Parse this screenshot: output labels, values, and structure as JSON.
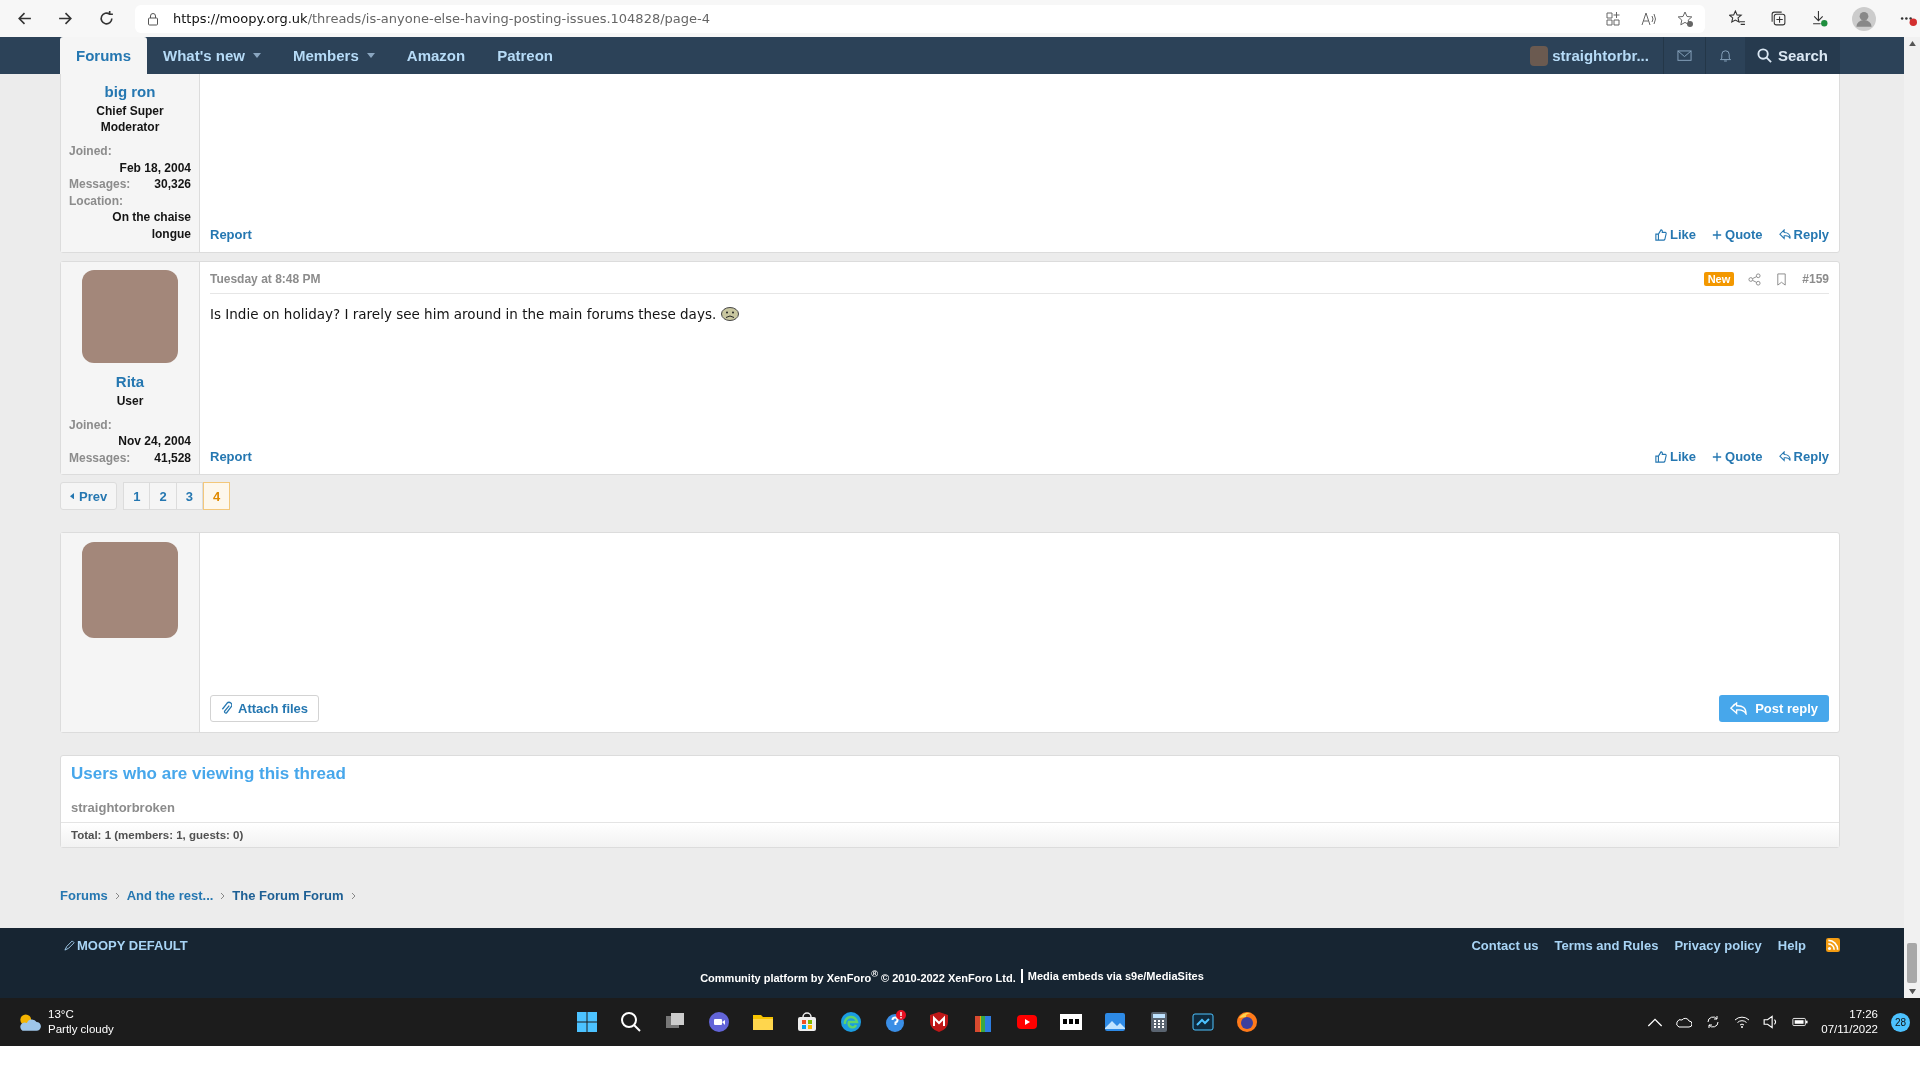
{
  "browser": {
    "url_host": "https://moopy.org.uk",
    "url_path": "/threads/is-anyone-else-having-posting-issues.104828/page-4"
  },
  "nav": {
    "items": [
      {
        "label": "Forums",
        "selected": true,
        "dropdown": false
      },
      {
        "label": "What's new",
        "selected": false,
        "dropdown": true
      },
      {
        "label": "Members",
        "selected": false,
        "dropdown": true
      },
      {
        "label": "Amazon",
        "selected": false,
        "dropdown": false
      },
      {
        "label": "Patreon",
        "selected": false,
        "dropdown": false
      }
    ],
    "user": "straightorbr...",
    "search": "Search"
  },
  "posts": [
    {
      "author": "big ron",
      "role": "Chief Super Moderator",
      "stats": [
        {
          "label": "Joined:",
          "value": "Feb 18, 2004",
          "kind": "stacked"
        },
        {
          "label": "Messages:",
          "value": "30,326",
          "kind": "inline"
        },
        {
          "label": "Location:",
          "value": "On the chaise longue",
          "kind": "stacked"
        }
      ],
      "report": "Report",
      "actions": [
        "Like",
        "Quote",
        "Reply"
      ]
    },
    {
      "author": "Rita",
      "role": "User",
      "date": "Tuesday at 8:48 PM",
      "badge": "New",
      "number": "#159",
      "body": "Is Indie on holiday? I rarely see him around in the main forums these days.",
      "emoji": true,
      "stats": [
        {
          "label": "Joined:",
          "value": "Nov 24, 2004",
          "kind": "stacked"
        },
        {
          "label": "Messages:",
          "value": "41,528",
          "kind": "inline"
        }
      ],
      "report": "Report",
      "actions": [
        "Like",
        "Quote",
        "Reply"
      ]
    }
  ],
  "pagination": {
    "prev": "Prev",
    "pages": [
      {
        "label": "1",
        "selected": false
      },
      {
        "label": "2",
        "selected": false
      },
      {
        "label": "3",
        "selected": false
      },
      {
        "label": "4",
        "selected": true
      }
    ]
  },
  "reply": {
    "attach": "Attach files",
    "post": "Post reply"
  },
  "viewing": {
    "title": "Users who are viewing this thread",
    "users": [
      "straightorbroken"
    ],
    "total": "Total: 1 (members: 1, guests: 0)"
  },
  "breadcrumbs": [
    {
      "label": "Forums",
      "current": false
    },
    {
      "label": "And the rest...",
      "current": false
    },
    {
      "label": "The Forum Forum",
      "current": true
    }
  ],
  "footer": {
    "style": "MOOPY DEFAULT",
    "links": [
      "Contact us",
      "Terms and Rules",
      "Privacy policy",
      "Help"
    ],
    "platform": "Community platform by XenForo$^{®}$ © 2010-2022 XenForo Ltd.",
    "embeds": "Media embeds via s9e/MediaSites"
  },
  "taskbar": {
    "temp": "13°C",
    "weather": "Partly cloudy",
    "time": "17:26",
    "date": "07/11/2022",
    "notifications": "28"
  }
}
